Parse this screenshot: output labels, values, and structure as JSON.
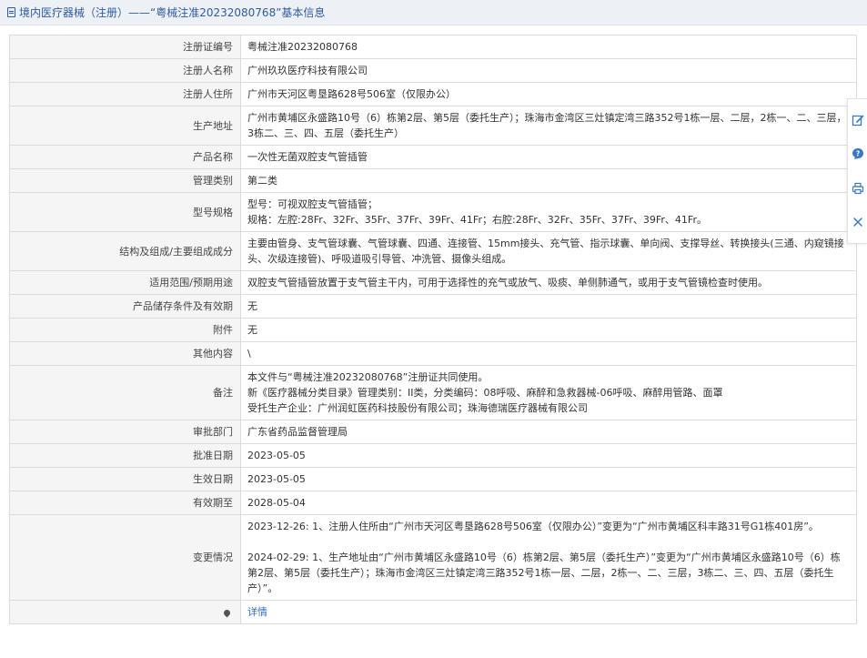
{
  "header": {
    "title": "境内医疗器械（注册）——“粤械注准20232080768”基本信息"
  },
  "rows": [
    {
      "label": "注册证编号",
      "lines": [
        "粤械注准20232080768"
      ]
    },
    {
      "label": "注册人名称",
      "lines": [
        "广州玖玖医疗科技有限公司"
      ]
    },
    {
      "label": "注册人住所",
      "lines": [
        "广州市天河区粤垦路628号506室（仅限办公）"
      ]
    },
    {
      "label": "生产地址",
      "lines": [
        "广州市黄埔区永盛路10号（6）栋第2层、第5层（委托生产）；珠海市金湾区三灶镇定湾三路352号1栋一层、二层，2栋一、二、三层，3栋二、三、四、五层（委托生产）"
      ]
    },
    {
      "label": "产品名称",
      "lines": [
        "一次性无菌双腔支气管插管"
      ]
    },
    {
      "label": "管理类别",
      "lines": [
        "第二类"
      ]
    },
    {
      "label": "型号规格",
      "lines": [
        "型号：可视双腔支气管插管；",
        "规格：左腔:28Fr、32Fr、35Fr、37Fr、39Fr、41Fr；右腔:28Fr、32Fr、35Fr、37Fr、39Fr、41Fr。"
      ]
    },
    {
      "label": "结构及组成/主要组成成分",
      "lines": [
        "主要由管身、支气管球囊、气管球囊、四通、连接管、15mm接头、充气管、指示球囊、单向阀、支撑导丝、转换接头(三通、内窥镜接头、次级连接管)、呼吸道吸引导管、冲洗管、摄像头组成。"
      ]
    },
    {
      "label": "适用范围/预期用途",
      "lines": [
        "双腔支气管插管放置于支气管主干内，可用于选择性的充气或放气、吸痰、单侧肺通气，或用于支气管镜检查时使用。"
      ]
    },
    {
      "label": "产品储存条件及有效期",
      "lines": [
        "无"
      ]
    },
    {
      "label": "附件",
      "lines": [
        "无"
      ]
    },
    {
      "label": "其他内容",
      "lines": [
        "\\"
      ]
    },
    {
      "label": "备注",
      "lines": [
        "本文件与“粤械注准20232080768”注册证共同使用。",
        "新《医疗器械分类目录》管理类别：II类，分类编码：08呼吸、麻醉和急救器械-06呼吸、麻醉用管路、面罩",
        "受托生产企业：广州润虹医药科技股份有限公司；珠海德瑞医疗器械有限公司"
      ]
    },
    {
      "label": "审批部门",
      "lines": [
        "广东省药品监督管理局"
      ]
    },
    {
      "label": "批准日期",
      "lines": [
        "2023-05-05"
      ]
    },
    {
      "label": "生效日期",
      "lines": [
        "2023-05-05"
      ]
    },
    {
      "label": "有效期至",
      "lines": [
        "2028-05-04"
      ]
    },
    {
      "label": "变更情况",
      "lines": [
        "2023-12-26: 1、注册人住所由“广州市天河区粤垦路628号506室（仅限办公）”变更为“广州市黄埔区科丰路31号G1栋401房”。",
        "",
        "2024-02-29: 1、生产地址由“广州市黄埔区永盛路10号（6）栋第2层、第5层（委托生产）”变更为“广州市黄埔区永盛路10号（6）栋第2层、第5层（委托生产）；珠海市金湾区三灶镇定湾三路352号1栋一层、二层，2栋一、二、三层，3栋二、三、四、五层（委托生产）”。"
      ]
    }
  ],
  "detail": {
    "link_text": "详情"
  },
  "sidebar_tools": [
    {
      "name": "edit-icon"
    },
    {
      "name": "help-icon"
    },
    {
      "name": "print-icon"
    },
    {
      "name": "close-icon"
    }
  ]
}
